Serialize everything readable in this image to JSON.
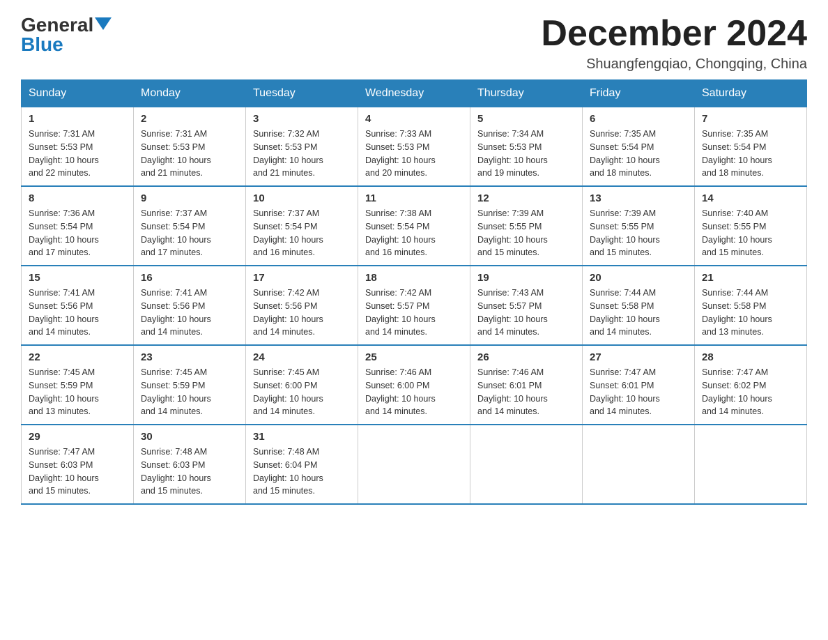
{
  "logo": {
    "general": "General",
    "blue": "Blue"
  },
  "title": "December 2024",
  "subtitle": "Shuangfengqiao, Chongqing, China",
  "headers": [
    "Sunday",
    "Monday",
    "Tuesday",
    "Wednesday",
    "Thursday",
    "Friday",
    "Saturday"
  ],
  "weeks": [
    [
      {
        "day": "1",
        "sunrise": "7:31 AM",
        "sunset": "5:53 PM",
        "daylight": "10 hours and 22 minutes."
      },
      {
        "day": "2",
        "sunrise": "7:31 AM",
        "sunset": "5:53 PM",
        "daylight": "10 hours and 21 minutes."
      },
      {
        "day": "3",
        "sunrise": "7:32 AM",
        "sunset": "5:53 PM",
        "daylight": "10 hours and 21 minutes."
      },
      {
        "day": "4",
        "sunrise": "7:33 AM",
        "sunset": "5:53 PM",
        "daylight": "10 hours and 20 minutes."
      },
      {
        "day": "5",
        "sunrise": "7:34 AM",
        "sunset": "5:53 PM",
        "daylight": "10 hours and 19 minutes."
      },
      {
        "day": "6",
        "sunrise": "7:35 AM",
        "sunset": "5:54 PM",
        "daylight": "10 hours and 18 minutes."
      },
      {
        "day": "7",
        "sunrise": "7:35 AM",
        "sunset": "5:54 PM",
        "daylight": "10 hours and 18 minutes."
      }
    ],
    [
      {
        "day": "8",
        "sunrise": "7:36 AM",
        "sunset": "5:54 PM",
        "daylight": "10 hours and 17 minutes."
      },
      {
        "day": "9",
        "sunrise": "7:37 AM",
        "sunset": "5:54 PM",
        "daylight": "10 hours and 17 minutes."
      },
      {
        "day": "10",
        "sunrise": "7:37 AM",
        "sunset": "5:54 PM",
        "daylight": "10 hours and 16 minutes."
      },
      {
        "day": "11",
        "sunrise": "7:38 AM",
        "sunset": "5:54 PM",
        "daylight": "10 hours and 16 minutes."
      },
      {
        "day": "12",
        "sunrise": "7:39 AM",
        "sunset": "5:55 PM",
        "daylight": "10 hours and 15 minutes."
      },
      {
        "day": "13",
        "sunrise": "7:39 AM",
        "sunset": "5:55 PM",
        "daylight": "10 hours and 15 minutes."
      },
      {
        "day": "14",
        "sunrise": "7:40 AM",
        "sunset": "5:55 PM",
        "daylight": "10 hours and 15 minutes."
      }
    ],
    [
      {
        "day": "15",
        "sunrise": "7:41 AM",
        "sunset": "5:56 PM",
        "daylight": "10 hours and 14 minutes."
      },
      {
        "day": "16",
        "sunrise": "7:41 AM",
        "sunset": "5:56 PM",
        "daylight": "10 hours and 14 minutes."
      },
      {
        "day": "17",
        "sunrise": "7:42 AM",
        "sunset": "5:56 PM",
        "daylight": "10 hours and 14 minutes."
      },
      {
        "day": "18",
        "sunrise": "7:42 AM",
        "sunset": "5:57 PM",
        "daylight": "10 hours and 14 minutes."
      },
      {
        "day": "19",
        "sunrise": "7:43 AM",
        "sunset": "5:57 PM",
        "daylight": "10 hours and 14 minutes."
      },
      {
        "day": "20",
        "sunrise": "7:44 AM",
        "sunset": "5:58 PM",
        "daylight": "10 hours and 14 minutes."
      },
      {
        "day": "21",
        "sunrise": "7:44 AM",
        "sunset": "5:58 PM",
        "daylight": "10 hours and 13 minutes."
      }
    ],
    [
      {
        "day": "22",
        "sunrise": "7:45 AM",
        "sunset": "5:59 PM",
        "daylight": "10 hours and 13 minutes."
      },
      {
        "day": "23",
        "sunrise": "7:45 AM",
        "sunset": "5:59 PM",
        "daylight": "10 hours and 14 minutes."
      },
      {
        "day": "24",
        "sunrise": "7:45 AM",
        "sunset": "6:00 PM",
        "daylight": "10 hours and 14 minutes."
      },
      {
        "day": "25",
        "sunrise": "7:46 AM",
        "sunset": "6:00 PM",
        "daylight": "10 hours and 14 minutes."
      },
      {
        "day": "26",
        "sunrise": "7:46 AM",
        "sunset": "6:01 PM",
        "daylight": "10 hours and 14 minutes."
      },
      {
        "day": "27",
        "sunrise": "7:47 AM",
        "sunset": "6:01 PM",
        "daylight": "10 hours and 14 minutes."
      },
      {
        "day": "28",
        "sunrise": "7:47 AM",
        "sunset": "6:02 PM",
        "daylight": "10 hours and 14 minutes."
      }
    ],
    [
      {
        "day": "29",
        "sunrise": "7:47 AM",
        "sunset": "6:03 PM",
        "daylight": "10 hours and 15 minutes."
      },
      {
        "day": "30",
        "sunrise": "7:48 AM",
        "sunset": "6:03 PM",
        "daylight": "10 hours and 15 minutes."
      },
      {
        "day": "31",
        "sunrise": "7:48 AM",
        "sunset": "6:04 PM",
        "daylight": "10 hours and 15 minutes."
      },
      null,
      null,
      null,
      null
    ]
  ],
  "labels": {
    "sunrise": "Sunrise:",
    "sunset": "Sunset:",
    "daylight": "Daylight:"
  }
}
